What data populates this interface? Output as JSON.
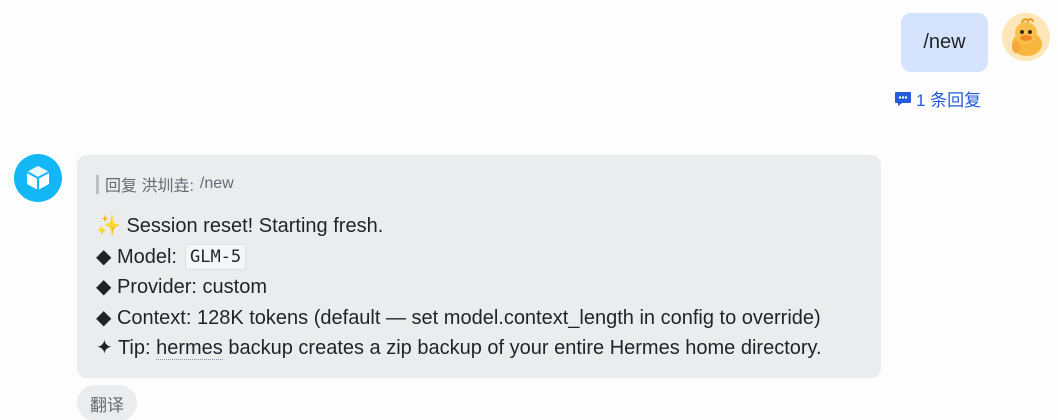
{
  "user_message": {
    "text": "/new",
    "reply_count_label": "1 条回复",
    "avatar_icon": "duck-avatar-icon"
  },
  "bot_message": {
    "avatar_icon": "cube-bot-icon",
    "quote": {
      "prefix": "回复 洪圳垚:",
      "target": "/new"
    },
    "lines": {
      "l1": "✨ Session reset! Starting fresh.",
      "l2_label": "◆ Model:",
      "l2_code": "GLM-5",
      "l3": "◆ Provider: custom",
      "l4": "◆ Context: 128K tokens (default — set model.context_length in config to override)",
      "l5_prefix": "✦ Tip: ",
      "l5_link": "hermes",
      "l5_suffix": " backup creates a zip backup of your entire Hermes home directory."
    }
  },
  "actions": {
    "translate_label": "翻译"
  },
  "colors": {
    "user_bubble": "#d5e3fd",
    "bot_bubble": "#ebeced",
    "link_blue": "#245bdb",
    "bot_avatar": "#12b7f5"
  }
}
